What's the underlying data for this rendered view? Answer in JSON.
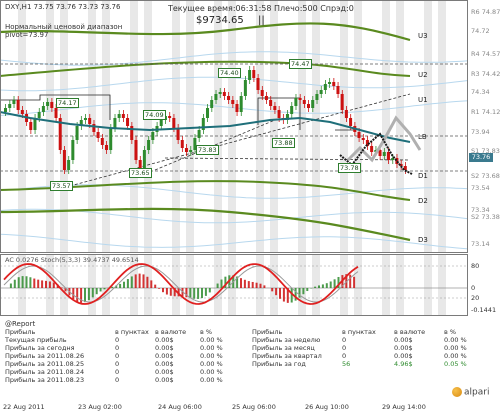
{
  "header": {
    "symbol": "DXY,H1  73.75 73.76 73.73 73.76",
    "server_time": "Текущее время:06:31:58 Плечо:500 Спрэд:0",
    "balance": "$9734.65",
    "pause_glyph": "||",
    "line1": "Нормальный ценовой диапазон",
    "line2": "pivot=73.97"
  },
  "levels": {
    "u3": "U3",
    "u2": "U2",
    "u1": "U1",
    "lb": "LB",
    "d1": "D1",
    "d2": "D2",
    "d3": "D3"
  },
  "price_axis": [
    {
      "label": "R6 74.87"
    },
    {
      "label": "74.72"
    },
    {
      "label": "R4 74.57"
    },
    {
      "label": "R3 74.42"
    },
    {
      "label": "74.34"
    },
    {
      "label": "R1 74.12"
    },
    {
      "label": "73.94"
    },
    {
      "label": "S1 73.83"
    },
    {
      "label": "S2 73.68"
    },
    {
      "label": "73.54"
    },
    {
      "label": "S2 73.38"
    },
    {
      "label": "73.34"
    },
    {
      "label": "73.14"
    }
  ],
  "current_price": "73.76",
  "value_boxes": [
    "74.17",
    "74.09",
    "73.57",
    "73.65",
    "73.83",
    "74.40",
    "74.47",
    "73.88",
    "73.78"
  ],
  "oscillator": {
    "label": "AC 0.0276  Stoch(5,3,3) 39.4737 49.6514",
    "scale": [
      "80",
      "20",
      "0",
      "-0.1441"
    ]
  },
  "report": {
    "title": "@Report",
    "left_headers": [
      "Прибыль",
      "в пунктах",
      "в валюте",
      "в %"
    ],
    "left_rows": [
      [
        "Текущая прибыль",
        "0",
        "0.00$",
        "0.00 %"
      ],
      [
        "Прибыль за сегодня",
        "0",
        "0.00$",
        "0.00 %"
      ],
      [
        "Прибыль за 2011.08.26",
        "0",
        "0.00$",
        "0.00 %"
      ],
      [
        "Прибыль за 2011.08.25",
        "0",
        "0.00$",
        "0.00 %"
      ],
      [
        "Прибыль за 2011.08.24",
        "0",
        "0.00$",
        "0.00 %"
      ],
      [
        "Прибыль за 2011.08.23",
        "0",
        "0.00$",
        "0.00 %"
      ]
    ],
    "right_headers": [
      "Прибыль",
      "в пунктах",
      "в валюте",
      "в %"
    ],
    "right_rows": [
      [
        "Прибыль за неделю",
        "0",
        "0.00$",
        "0.00 %"
      ],
      [
        "Прибыль за месяц",
        "0",
        "0.00$",
        "0.00 %"
      ],
      [
        "Прибыль за квартал",
        "0",
        "0.00$",
        "0.00 %"
      ],
      [
        "Прибыль за год",
        "56",
        "4.96$",
        "0.05 %"
      ]
    ]
  },
  "time_axis": [
    "22 Aug 2011",
    "23 Aug 02:00",
    "24 Aug 06:00",
    "25 Aug 06:00",
    "26 Aug 10:00",
    "29 Aug 14:00"
  ],
  "logo": "alpari",
  "colors": {
    "candle_bull": "#2e8b2e",
    "candle_bear": "#cc1111",
    "ma_teal": "#1f6f7a",
    "channel_green": "#5a8a1f",
    "stoch_red": "#e02020",
    "stoch_gray": "#9a9a9a"
  }
}
